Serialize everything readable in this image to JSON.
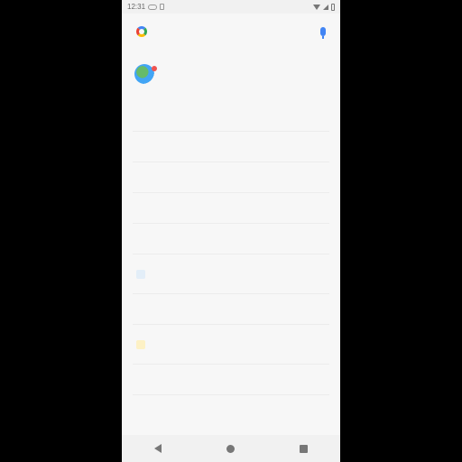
{
  "status_bar": {
    "time": "12:31",
    "icons": [
      "dual-sim-icon",
      "notification-icon",
      "wifi-icon",
      "signal-icon",
      "battery-icon"
    ]
  },
  "search": {
    "placeholder": "",
    "logo": "google-g-icon",
    "mic": "mic-icon"
  },
  "weather": {
    "icon": "weather-icon",
    "text": "",
    "side_text": ""
  },
  "feed": {
    "items": [
      {
        "text": ""
      },
      {
        "text": ""
      },
      {
        "text": ""
      },
      {
        "text": ""
      },
      {
        "text": ""
      },
      {
        "text": ""
      },
      {
        "text": ""
      },
      {
        "text": ""
      },
      {
        "text": ""
      },
      {
        "text": ""
      }
    ]
  },
  "nav_bar": {
    "back": "back-icon",
    "home": "home-icon",
    "recents": "recents-icon"
  },
  "colors": {
    "background": "#f7f7f7",
    "accent": "#4285f4"
  }
}
